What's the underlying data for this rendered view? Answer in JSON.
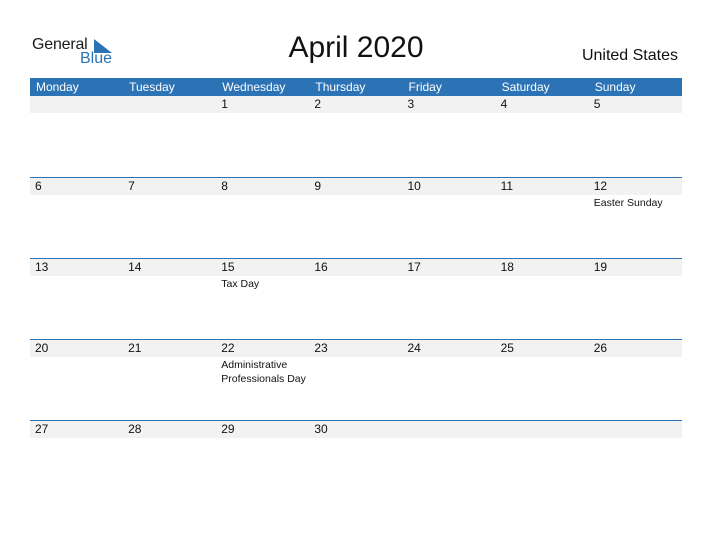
{
  "brand": {
    "word1": "General",
    "word2": "Blue",
    "accent": "#2c73b5"
  },
  "title": "April 2020",
  "country": "United States",
  "weekdays": [
    "Monday",
    "Tuesday",
    "Wednesday",
    "Thursday",
    "Friday",
    "Saturday",
    "Sunday"
  ],
  "weeks": [
    {
      "days": [
        "",
        "",
        "1",
        "2",
        "3",
        "4",
        "5"
      ],
      "events": [
        "",
        "",
        "",
        "",
        "",
        "",
        ""
      ]
    },
    {
      "days": [
        "6",
        "7",
        "8",
        "9",
        "10",
        "11",
        "12"
      ],
      "events": [
        "",
        "",
        "",
        "",
        "",
        "",
        "Easter Sunday"
      ]
    },
    {
      "days": [
        "13",
        "14",
        "15",
        "16",
        "17",
        "18",
        "19"
      ],
      "events": [
        "",
        "",
        "Tax Day",
        "",
        "",
        "",
        ""
      ]
    },
    {
      "days": [
        "20",
        "21",
        "22",
        "23",
        "24",
        "25",
        "26"
      ],
      "events": [
        "",
        "",
        "Administrative Professionals Day",
        "",
        "",
        "",
        ""
      ]
    },
    {
      "days": [
        "27",
        "28",
        "29",
        "30",
        "",
        "",
        ""
      ],
      "events": [
        "",
        "",
        "",
        "",
        "",
        "",
        ""
      ]
    }
  ]
}
